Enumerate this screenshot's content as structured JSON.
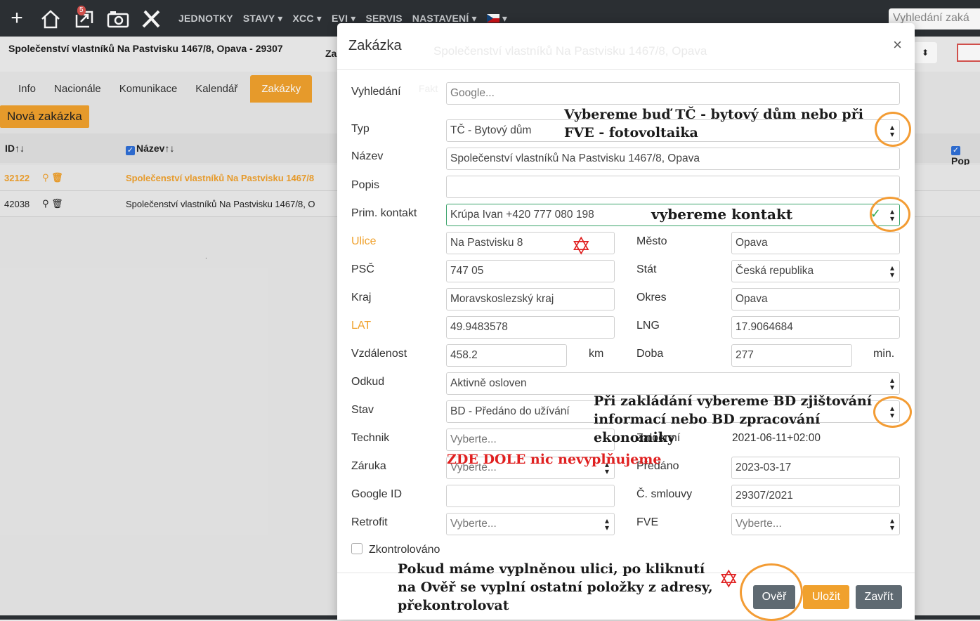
{
  "navbar": {
    "badge": "5",
    "links": [
      "JEDNOTKY",
      "STAVY ▾",
      "XCC ▾",
      "EVI ▾",
      "SERVIS",
      "NASTAVENÍ ▾",
      "▾"
    ],
    "search_placeholder": "Vyhledání zaká"
  },
  "background": {
    "title": "Společenství vlastníků Na Pastvisku 1467/8, Opava - 29307",
    "za": "Za",
    "tabs": [
      "Info",
      "Nacionále",
      "Komunikace",
      "Kalendář",
      "Zakázky"
    ],
    "new_button": "Nová zakázka",
    "columns": {
      "id": "ID↑↓",
      "name": "Název↑↓",
      "pop": "Pop"
    },
    "rows": [
      {
        "id": "32122",
        "name": "Společenství vlastníků Na Pastvisku 1467/8"
      },
      {
        "id": "42038",
        "name": "Společenství vlastníků Na Pastvisku 1467/8, O"
      }
    ],
    "dot": "."
  },
  "modal": {
    "title": "Zakázka",
    "ghost_title": "Společenství vlastníků Na Pastvisku 1467/8, Opava",
    "ghost2": "Fakt",
    "close": "×",
    "labels": {
      "search": "Vyhledání",
      "type": "Typ",
      "name": "Název",
      "desc": "Popis",
      "contact": "Prim. kontakt",
      "street": "Ulice",
      "city": "Město",
      "zip": "PSČ",
      "country": "Stát",
      "region": "Kraj",
      "district": "Okres",
      "lat": "LAT",
      "lng": "LNG",
      "distance": "Vzdálenost",
      "duration": "Doba",
      "source": "Odkud",
      "state": "Stav",
      "technician": "Technik",
      "created": "Zaloenní",
      "warranty": "Záruka",
      "handed": "Předáno",
      "google_id": "Google ID",
      "contract": "Č. smlouvy",
      "retrofit": "Retrofit",
      "fve": "FVE",
      "checked": "Zkontrolováno",
      "km": "km",
      "min": "min."
    },
    "values": {
      "search_placeholder": "Google...",
      "type": "TČ - Bytový dům",
      "name": "Společenství vlastníků Na Pastvisku 1467/8, Opava",
      "desc": "",
      "contact": "Krúpa Ivan +420 777 080 198",
      "street": "Na Pastvisku 8",
      "city": "Opava",
      "zip": "747 05",
      "country": "Česká republika",
      "region": "Moravskoslezský kraj",
      "district": "Opava",
      "lat": "49.9483578",
      "lng": "17.9064684",
      "distance": "458.2",
      "duration": "277",
      "source": "Aktivně osloven",
      "state": "BD - Předáno do užívání",
      "technician": "Vyberte...",
      "created": "2021-06-11+02:00",
      "warranty": "Vyberte...",
      "handed": "2023-03-17",
      "google_id": "",
      "contract": "29307/2021",
      "retrofit": "Vyberte...",
      "fve": "Vyberte..."
    },
    "buttons": {
      "verify": "Ověř",
      "save": "Uložit",
      "close": "Zavřít"
    }
  },
  "annotations": {
    "type_note_1": "Vybereme buď TČ - bytový dům nebo při",
    "type_note_2": "FVE - fotovoltaika",
    "contact_note": "vybereme kontakt",
    "state_note_1": "Při zakládání vybereme BD zjištování",
    "state_note_2": "informací nebo BD zpracování",
    "state_note_3": "ekonomiky",
    "below_note": "ZDE DOLE nic nevyplňujeme",
    "verify_note_1": "Pokud máme vyplněnou ulici, po kliknutí",
    "verify_note_2": "na Ověř se vyplní ostatní položky z adresy,",
    "verify_note_3": "překontrolovat"
  }
}
